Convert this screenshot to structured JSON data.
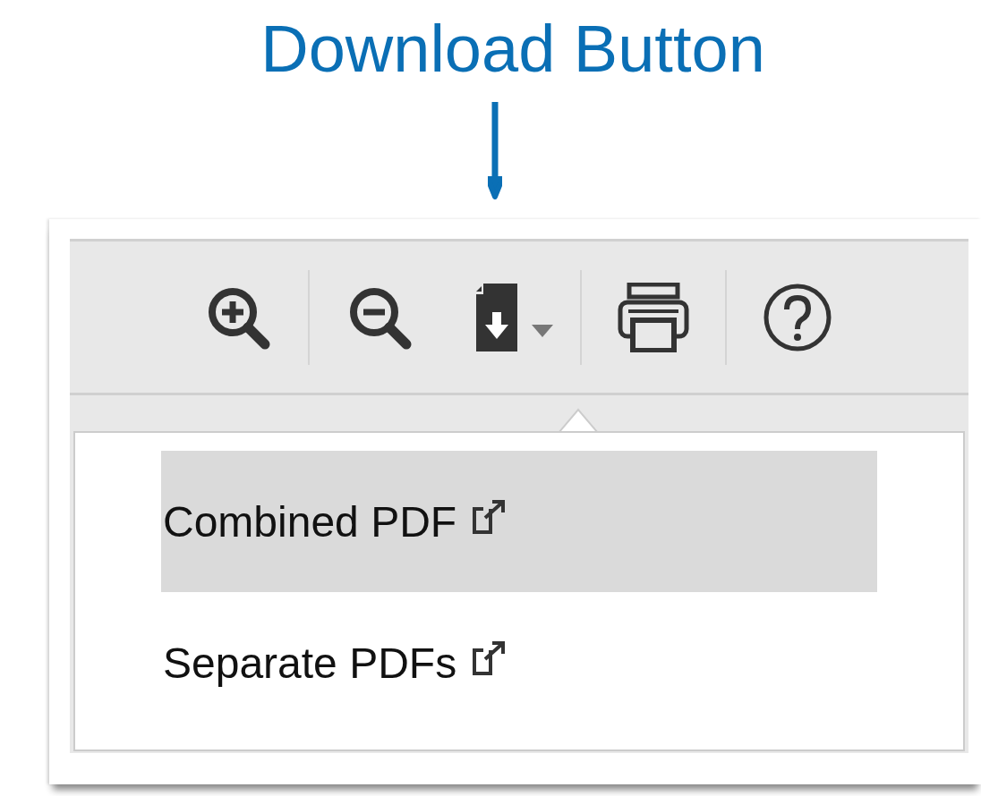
{
  "annotation": {
    "title": "Download Button"
  },
  "toolbar": [
    {
      "kind": "zoom-in"
    },
    {
      "kind": "separator"
    },
    {
      "kind": "zoom-out"
    },
    {
      "kind": "download"
    },
    {
      "kind": "separator"
    },
    {
      "kind": "print"
    },
    {
      "kind": "separator"
    },
    {
      "kind": "help"
    }
  ],
  "menu": [
    {
      "label": "Combined PDF",
      "selected": true
    },
    {
      "label": "Separate PDFs",
      "selected": false
    }
  ]
}
